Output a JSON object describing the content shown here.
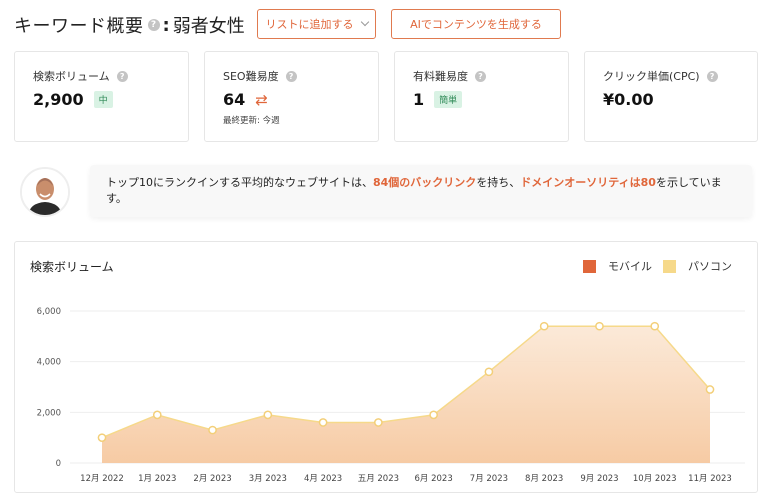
{
  "header": {
    "title": "キーワード概要",
    "help": "?",
    "separator": ":",
    "keyword": "弱者女性"
  },
  "buttons": {
    "add_to_list": "リストに追加する",
    "generate_ai": "AIでコンテンツを生成する"
  },
  "metrics": [
    {
      "label": "検索ボリューム",
      "value": "2,900",
      "badge": "中"
    },
    {
      "label": "SEO難易度",
      "value": "64",
      "sub": "最終更新: 今週"
    },
    {
      "label": "有料難易度",
      "value": "1",
      "badge": "簡単"
    },
    {
      "label": "クリック単価(CPC)",
      "value": "¥0.00"
    }
  ],
  "insight": {
    "t1": "トップ10にランクインする平均的なウェブサイトは、",
    "h1": "84個のバックリンク",
    "t2": "を持ち、",
    "h2": "ドメインオーソリティは80",
    "t3": "を示しています。"
  },
  "colors": {
    "accent": "#e0663a",
    "mobile": "#e0663a",
    "desktop": "#f6d98a"
  },
  "chart_data": {
    "type": "area",
    "title": "検索ボリューム",
    "categories": [
      "12月 2022",
      "1月 2023",
      "2月 2023",
      "3月 2023",
      "4月 2023",
      "五月 2023",
      "6月 2023",
      "7月 2023",
      "8月 2023",
      "9月 2023",
      "10月 2023",
      "11月 2023"
    ],
    "series": [
      {
        "name": "モバイル",
        "color": "#e0663a",
        "values": [
          0,
          0,
          0,
          0,
          0,
          0,
          0,
          0,
          0,
          0,
          0,
          0
        ]
      },
      {
        "name": "パソコン",
        "color": "#f6d98a",
        "values": [
          1000,
          1900,
          1300,
          1900,
          1600,
          1600,
          1900,
          3600,
          5400,
          5400,
          5400,
          2900
        ]
      }
    ],
    "yticks": [
      "0",
      "2,000",
      "4,000",
      "6,000"
    ],
    "ylim": [
      0,
      6000
    ],
    "grid": true,
    "legend": "top-right"
  }
}
